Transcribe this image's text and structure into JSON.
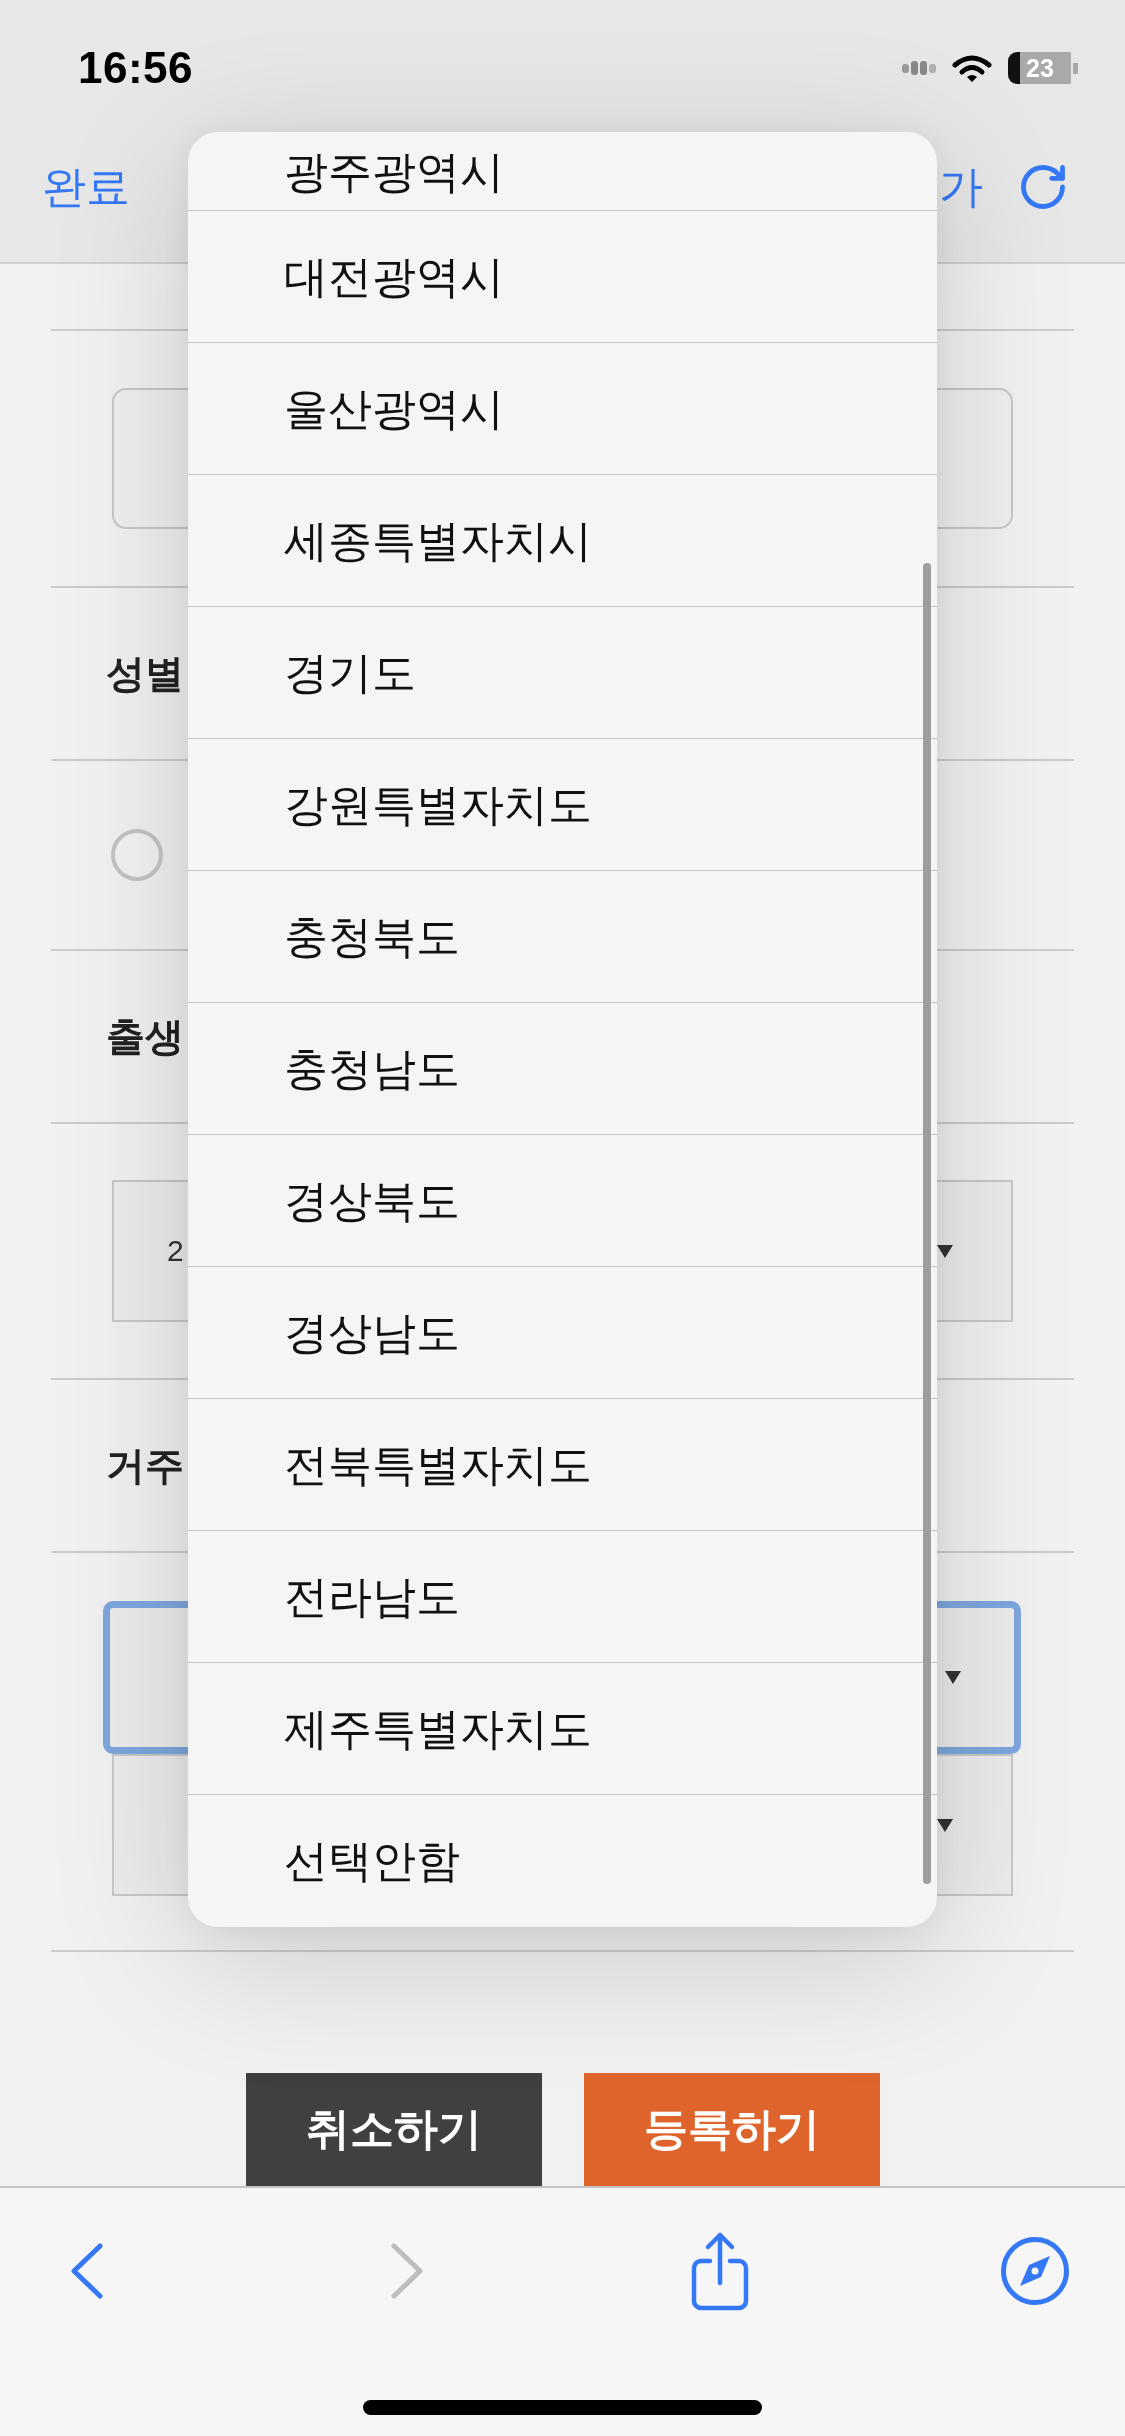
{
  "status_bar": {
    "time": "16:56",
    "battery": "23"
  },
  "nav_bar": {
    "done_label": "완료",
    "right_label": "가"
  },
  "form": {
    "sections": [
      {
        "kind": "input"
      },
      {
        "kind": "label",
        "text": "성별"
      },
      {
        "kind": "radio",
        "checked": false
      },
      {
        "kind": "label",
        "text": "출생"
      },
      {
        "kind": "select",
        "selects": [
          {
            "value": "2",
            "focused": false
          }
        ]
      },
      {
        "kind": "label",
        "text": "거주"
      },
      {
        "kind": "select",
        "selects": [
          {
            "focused": true
          },
          {
            "focused": false
          }
        ]
      }
    ]
  },
  "buttons": [
    {
      "label": "취소하기",
      "kind": "secondary"
    },
    {
      "label": "등록하기",
      "kind": "primary"
    }
  ],
  "picker": {
    "options": [
      "광주광역시",
      "대전광역시",
      "울산광역시",
      "세종특별자치시",
      "경기도",
      "강원특별자치도",
      "충청북도",
      "충청남도",
      "경상북도",
      "경상남도",
      "전북특별자치도",
      "전라남도",
      "제주특별자치도",
      "선택안함"
    ]
  },
  "toolbar": {
    "items": [
      {
        "kind": "back",
        "disabled": false
      },
      {
        "kind": "forward",
        "disabled": true
      },
      {
        "kind": "share",
        "disabled": false
      },
      {
        "kind": "compass",
        "disabled": false
      }
    ]
  }
}
